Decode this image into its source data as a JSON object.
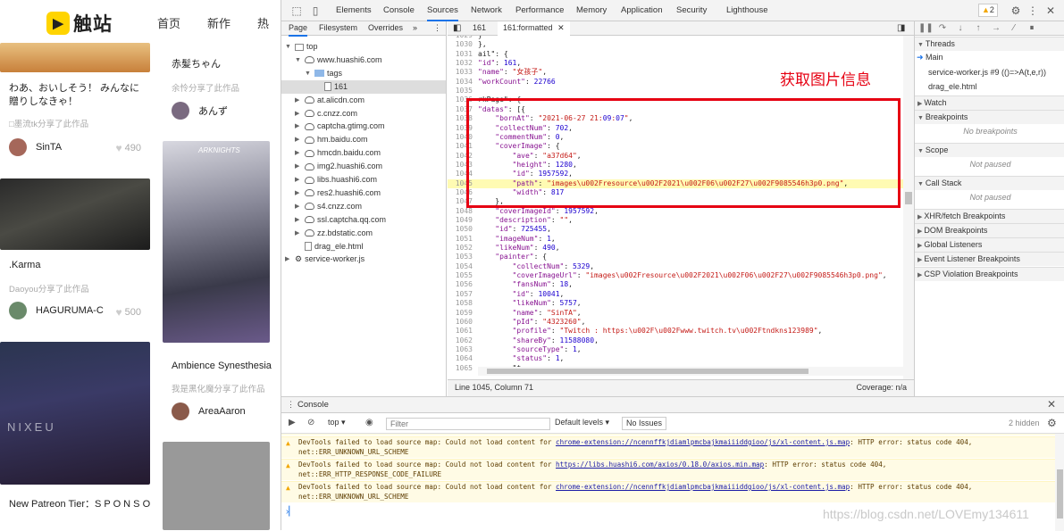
{
  "site": {
    "logo_text": "触站",
    "nav": [
      "首页",
      "新作",
      "热"
    ],
    "col1": [
      {
        "title": "わあ、おいしそう！ みんなに贈りしなきゃ！",
        "sub": "□墨流tk分享了此作品",
        "user": "SinTA",
        "likes": "490"
      },
      {
        "title": ".Karma",
        "sub": "Daoyou分享了此作品",
        "user": "HAGURUMA-C",
        "likes": "500"
      },
      {
        "title": "New Patreon Tier：S P O N S O R"
      }
    ],
    "col2": [
      {
        "title": "赤髪ちゃん",
        "sub": "余怜分享了此作品",
        "user": "あんず"
      },
      {
        "title": "Ambience Synesthesia",
        "sub": "我是黑化魔分享了此作品",
        "user": "AreaAaron"
      }
    ],
    "image_texts": {
      "arknights": "ARKNIGHTS",
      "nixeu": "NIXEU"
    }
  },
  "devtools": {
    "tabs": [
      "Elements",
      "Console",
      "Sources",
      "Network",
      "Performance",
      "Memory",
      "Application",
      "Security",
      "Lighthouse"
    ],
    "active_tab": "Sources",
    "warning_badge": "2",
    "navigator": {
      "tabs": [
        "Page",
        "Filesystem",
        "Overrides"
      ],
      "tree": [
        {
          "label": "top",
          "depth": 0,
          "icon": "frame-icon",
          "open": true
        },
        {
          "label": "www.huashi6.com",
          "depth": 1,
          "icon": "cloud-icon",
          "open": true
        },
        {
          "label": "tags",
          "depth": 2,
          "icon": "folder-icon",
          "open": true
        },
        {
          "label": "161",
          "depth": 3,
          "icon": "file-icon",
          "selected": true
        },
        {
          "label": "at.alicdn.com",
          "depth": 1,
          "icon": "cloud-icon"
        },
        {
          "label": "c.cnzz.com",
          "depth": 1,
          "icon": "cloud-icon"
        },
        {
          "label": "captcha.gtimg.com",
          "depth": 1,
          "icon": "cloud-icon"
        },
        {
          "label": "hm.baidu.com",
          "depth": 1,
          "icon": "cloud-icon"
        },
        {
          "label": "hmcdn.baidu.com",
          "depth": 1,
          "icon": "cloud-icon"
        },
        {
          "label": "img2.huashi6.com",
          "depth": 1,
          "icon": "cloud-icon"
        },
        {
          "label": "libs.huashi6.com",
          "depth": 1,
          "icon": "cloud-icon"
        },
        {
          "label": "res2.huashi6.com",
          "depth": 1,
          "icon": "cloud-icon"
        },
        {
          "label": "s4.cnzz.com",
          "depth": 1,
          "icon": "cloud-icon"
        },
        {
          "label": "ssl.captcha.qq.com",
          "depth": 1,
          "icon": "cloud-icon"
        },
        {
          "label": "zz.bdstatic.com",
          "depth": 1,
          "icon": "cloud-icon"
        },
        {
          "label": "drag_ele.html",
          "depth": 1,
          "icon": "file-icon",
          "leaf": true
        },
        {
          "label": "service-worker.js",
          "depth": 0,
          "icon": "gear-icon"
        }
      ]
    },
    "editor": {
      "tabs": [
        "161",
        "161:formatted"
      ],
      "active_tab": "161:formatted",
      "annotation": "获取图片信息",
      "lines": [
        {
          "n": "1029",
          "t": "}"
        },
        {
          "n": "1030",
          "t": "},"
        },
        {
          "n": "1031",
          "t": "ail\": {"
        },
        {
          "n": "1032",
          "t": "\"id\": 161,"
        },
        {
          "n": "1033",
          "t": "\"name\": \"女孩子\","
        },
        {
          "n": "1034",
          "t": "\"workCount\": 22766"
        },
        {
          "n": "1035",
          "t": ""
        },
        {
          "n": "1036",
          "t": "rkPage\": {"
        },
        {
          "n": "1037",
          "t": "\"datas\": [{"
        },
        {
          "n": "1038",
          "t": "    \"bornAt\": \"2021-06-27 21:09:07\","
        },
        {
          "n": "1039",
          "t": "    \"collectNum\": 702,"
        },
        {
          "n": "1040",
          "t": "    \"commentNum\": 0,"
        },
        {
          "n": "1041",
          "t": "    \"coverImage\": {"
        },
        {
          "n": "1042",
          "t": "        \"ave\": \"a37d64\","
        },
        {
          "n": "1043",
          "t": "        \"height\": 1280,"
        },
        {
          "n": "1044",
          "t": "        \"id\": 1957592,"
        },
        {
          "n": "1045",
          "t": "        \"path\": \"images\\u002Fresource\\u002F2021\\u002F06\\u002F27\\u002F9085546h3p0.png\",",
          "hl": true
        },
        {
          "n": "1046",
          "t": "        \"width\": 817"
        },
        {
          "n": "1047",
          "t": "    },"
        },
        {
          "n": "1048",
          "t": "    \"coverImageId\": 1957592,"
        },
        {
          "n": "1049",
          "t": "    \"description\": \"\","
        },
        {
          "n": "1050",
          "t": "    \"id\": 725455,"
        },
        {
          "n": "1051",
          "t": "    \"imageNum\": 1,"
        },
        {
          "n": "1052",
          "t": "    \"likeNum\": 490,"
        },
        {
          "n": "1053",
          "t": "    \"painter\": {"
        },
        {
          "n": "1054",
          "t": "        \"collectNum\": 5329,"
        },
        {
          "n": "1055",
          "t": "        \"coverImageUrl\": \"images\\u002Fresource\\u002F2021\\u002F06\\u002F27\\u002F9085546h3p0.png\","
        },
        {
          "n": "1056",
          "t": "        \"fansNum\": 18,"
        },
        {
          "n": "1057",
          "t": "        \"id\": 10041,"
        },
        {
          "n": "1058",
          "t": "        \"likeNum\": 5757,"
        },
        {
          "n": "1059",
          "t": "        \"name\": \"SinTA\","
        },
        {
          "n": "1060",
          "t": "        \"pId\": \"4323260\","
        },
        {
          "n": "1061",
          "t": "        \"profile\": \"Twitch : https:\\u002F\\u002Fwww.twitch.tv\\u002Ftndkns123989\","
        },
        {
          "n": "1062",
          "t": "        \"shareBy\": 11588080,"
        },
        {
          "n": "1063",
          "t": "        \"sourceType\": 1,"
        },
        {
          "n": "1064",
          "t": "        \"status\": 1,"
        },
        {
          "n": "1065",
          "t": "        \"t..."
        }
      ],
      "cursor": "Line 1045, Column 71",
      "coverage": "Coverage: n/a"
    },
    "debugger": {
      "sections": [
        {
          "title": "Threads",
          "open": true,
          "items": [
            "Main",
            "service-worker.js #9 (()=>A(t,e,r))",
            "drag_ele.html"
          ]
        },
        {
          "title": "Watch",
          "open": false
        },
        {
          "title": "Breakpoints",
          "open": true,
          "empty": "No breakpoints"
        },
        {
          "title": "Scope",
          "open": true,
          "empty": "Not paused"
        },
        {
          "title": "Call Stack",
          "open": true,
          "empty": "Not paused"
        },
        {
          "title": "XHR/fetch Breakpoints",
          "open": false
        },
        {
          "title": "DOM Breakpoints",
          "open": false
        },
        {
          "title": "Global Listeners",
          "open": false
        },
        {
          "title": "Event Listener Breakpoints",
          "open": false
        },
        {
          "title": "CSP Violation Breakpoints",
          "open": false
        }
      ]
    },
    "console": {
      "tab": "Console",
      "context": "top",
      "filter_placeholder": "Filter",
      "levels": "Default levels",
      "no_issues": "No Issues",
      "hidden": "2 hidden",
      "warnings": [
        {
          "pre": "DevTools failed to load source map: Could not load content for ",
          "link": "chrome-extension://ncennffkjdiamlpmcbajkmaiiiddgioo/js/xl-content.js.map",
          "post": ": HTTP error: status code 404,",
          "line2": "net::ERR_UNKNOWN_URL_SCHEME"
        },
        {
          "pre": "DevTools failed to load source map: Could not load content for ",
          "link": "https://libs.huashi6.com/axios/0.18.0/axios.min.map",
          "post": ": HTTP error: status code 404,",
          "line2": "net::ERR_HTTP_RESPONSE_CODE_FAILURE"
        },
        {
          "pre": "DevTools failed to load source map: Could not load content for ",
          "link": "chrome-extension://ncennffkjdiamlpmcbajkmaiiiddgioo/js/xl-content.js.map",
          "post": ": HTTP error: status code 404,",
          "line2": "net::ERR_UNKNOWN_URL_SCHEME"
        }
      ]
    }
  },
  "watermark": "https://blog.csdn.net/LOVEmy134611"
}
